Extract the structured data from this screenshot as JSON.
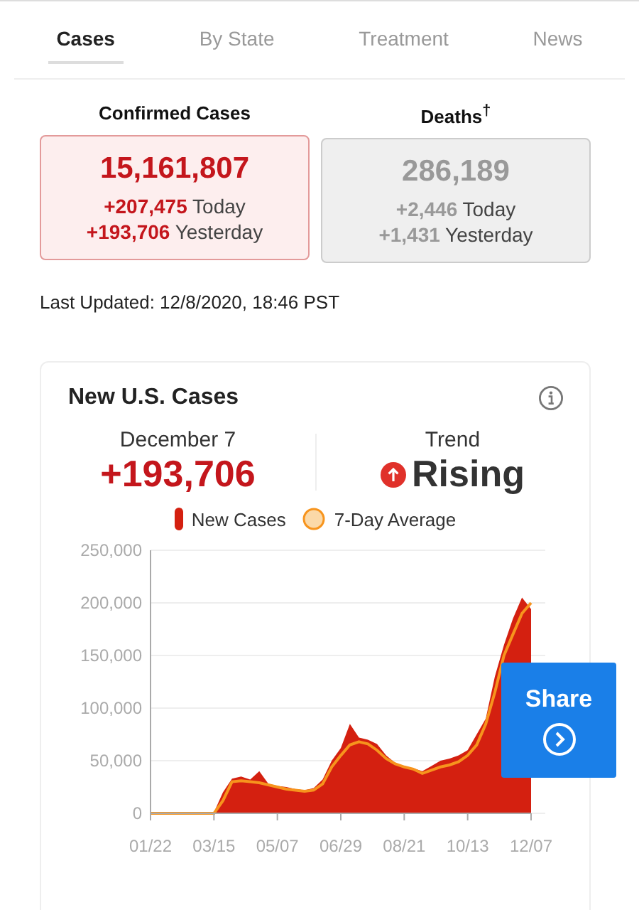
{
  "tabs": [
    {
      "label": "Cases",
      "selected": true
    },
    {
      "label": "By State",
      "selected": false
    },
    {
      "label": "Treatment",
      "selected": false
    },
    {
      "label": "News",
      "selected": false
    }
  ],
  "stats": [
    {
      "kind": "cases",
      "title": "Confirmed Cases",
      "total": "15,161,807",
      "today": "+207,475",
      "today_label": "Today",
      "yesterday": "+193,706",
      "yesterday_label": "Yesterday"
    },
    {
      "kind": "deaths",
      "title": "Deaths$^{†}$",
      "total": "286,189",
      "today": "+2,446",
      "today_label": "Today",
      "yesterday": "+1,431",
      "yesterday_label": "Yesterday"
    }
  ],
  "last_updated": "Last Updated: 12/8/2020, 18:46 PST",
  "card": {
    "title": "New U.S. Cases",
    "date": "December 7",
    "date_value": "+193,706",
    "trend_label": "Trend",
    "trend": "Rising",
    "chart_data": {
      "type": "area",
      "categories": [
        "01/22",
        null,
        null,
        null,
        null,
        null,
        null,
        "03/15",
        null,
        null,
        null,
        null,
        null,
        null,
        "05/07",
        null,
        null,
        null,
        null,
        null,
        null,
        "06/29",
        null,
        null,
        null,
        null,
        null,
        null,
        "08/21",
        null,
        null,
        null,
        null,
        null,
        null,
        "10/13",
        null,
        null,
        null,
        null,
        null,
        null,
        "12/07"
      ],
      "grid": true,
      "series": [
        {
          "name": "New Cases",
          "color": "#d42010",
          "values": [
            0,
            0,
            0,
            0,
            0,
            0,
            0,
            1000,
            20000,
            33000,
            35000,
            32000,
            40000,
            28000,
            26000,
            25000,
            23000,
            22000,
            24000,
            32000,
            50000,
            62000,
            85000,
            72000,
            70000,
            66000,
            55000,
            48000,
            44000,
            43000,
            40000,
            45000,
            50000,
            52000,
            55000,
            60000,
            75000,
            90000,
            130000,
            160000,
            185000,
            205000,
            194000
          ]
        },
        {
          "name": "7-Day Average",
          "type": "line",
          "color": "#f7941d",
          "values": [
            0,
            0,
            0,
            0,
            0,
            0,
            0,
            0,
            12000,
            30000,
            31000,
            30000,
            29000,
            27000,
            25000,
            23000,
            22000,
            21000,
            22000,
            28000,
            44000,
            55000,
            65000,
            68000,
            66000,
            60000,
            52000,
            47000,
            44000,
            42000,
            38000,
            41000,
            44000,
            46000,
            49000,
            55000,
            65000,
            85000,
            115000,
            150000,
            170000,
            190000,
            200000
          ]
        }
      ],
      "ylim": [
        0,
        250000
      ],
      "yticks": [
        {
          "value": 0,
          "label": "0"
        },
        {
          "value": 50000,
          "label": "50,000"
        },
        {
          "value": 100000,
          "label": "100,000"
        },
        {
          "value": 150000,
          "label": "150,000"
        },
        {
          "value": 200000,
          "label": "200,000"
        },
        {
          "value": 250000,
          "label": "250,000"
        }
      ]
    }
  },
  "share": {
    "label": "Share"
  }
}
